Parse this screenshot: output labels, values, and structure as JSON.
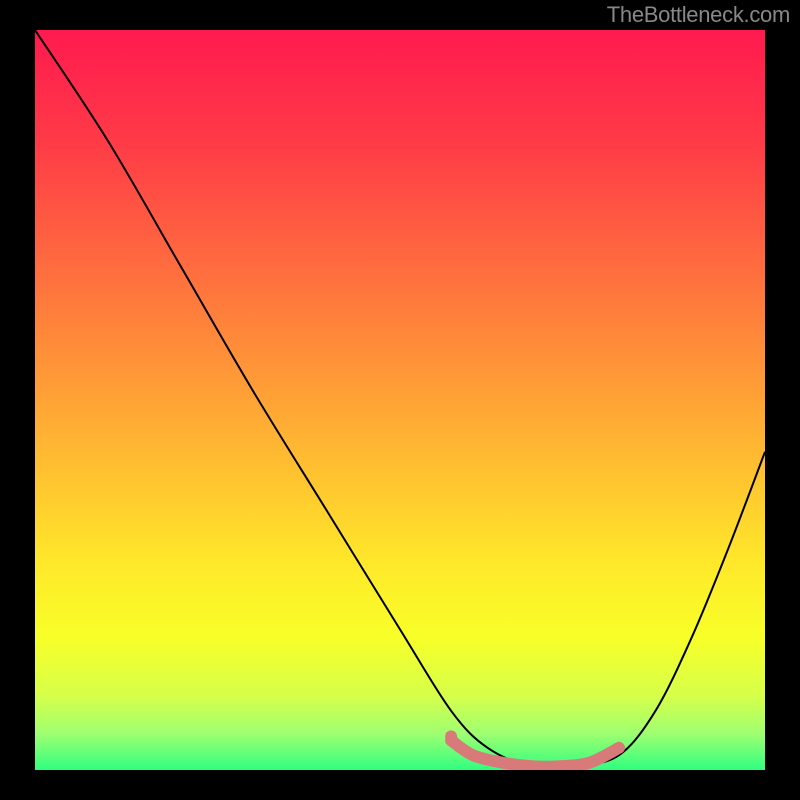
{
  "watermark": "TheBottleneck.com",
  "chart_data": {
    "type": "line",
    "title": "",
    "xlabel": "",
    "ylabel": "",
    "xlim": [
      0,
      100
    ],
    "ylim": [
      0,
      100
    ],
    "series": [
      {
        "name": "bottleneck-curve",
        "x": [
          0,
          10,
          20,
          30,
          40,
          50,
          57,
          62,
          68,
          74,
          80,
          85,
          90,
          95,
          100
        ],
        "y": [
          100,
          85,
          68,
          51,
          35,
          19,
          8,
          3,
          0.5,
          0.5,
          2,
          8,
          18,
          30,
          43
        ],
        "color": "#000000"
      },
      {
        "name": "optimal-zone",
        "x": [
          57,
          60,
          64,
          68,
          72,
          76,
          80
        ],
        "y": [
          4,
          2,
          1,
          0.5,
          0.5,
          1,
          3
        ],
        "color": "#d97a7a"
      }
    ],
    "background_gradient": {
      "type": "vertical",
      "stops": [
        {
          "offset": 0.0,
          "color": "#ff1a4f"
        },
        {
          "offset": 0.15,
          "color": "#ff3a47"
        },
        {
          "offset": 0.3,
          "color": "#ff6640"
        },
        {
          "offset": 0.45,
          "color": "#ff9338"
        },
        {
          "offset": 0.6,
          "color": "#ffc230"
        },
        {
          "offset": 0.72,
          "color": "#ffe82a"
        },
        {
          "offset": 0.82,
          "color": "#f8ff28"
        },
        {
          "offset": 0.9,
          "color": "#d6ff4a"
        },
        {
          "offset": 0.95,
          "color": "#a0ff70"
        },
        {
          "offset": 1.0,
          "color": "#30ff80"
        }
      ]
    }
  }
}
